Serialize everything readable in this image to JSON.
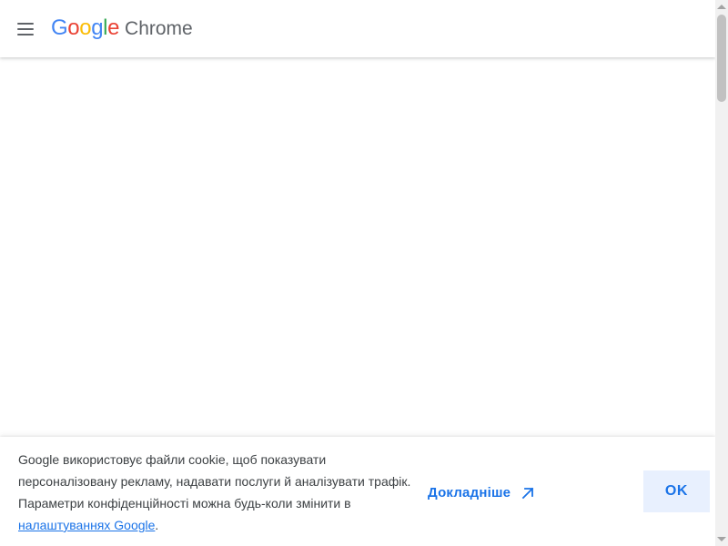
{
  "header": {
    "menu_icon": "hamburger-menu-icon",
    "brand": {
      "google_letters": [
        "G",
        "o",
        "o",
        "g",
        "l",
        "e"
      ],
      "product_name": "Chrome",
      "colors": [
        "#4285F4",
        "#EA4335",
        "#FBBC05",
        "#4285F4",
        "#34A853",
        "#EA4335"
      ]
    }
  },
  "cookie_banner": {
    "text_before_link": "Google використовує файли cookie, щоб показувати персоналізовану рекламу, надавати послуги й аналізувати трафік. Параметри конфіденційності можна будь-коли змінити в ",
    "settings_link": "налаштуваннях Google",
    "text_after_link": ".",
    "learn_more": "Докладніше",
    "learn_more_icon": "external-link-icon",
    "ok_button": "OK"
  },
  "scrollbar": {
    "up_arrow_icon": "scroll-up-arrow-icon",
    "down_arrow_icon": "scroll-down-arrow-icon"
  },
  "colors": {
    "link_blue": "#1a73e8",
    "button_background": "#e8f0fe",
    "text_gray": "#3c4043",
    "header_gray": "#5f6368"
  }
}
